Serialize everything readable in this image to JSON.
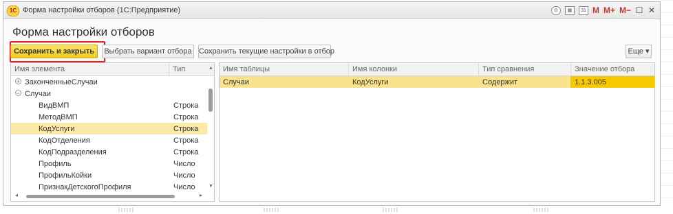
{
  "window": {
    "title": "Форма настройки отборов  (1С:Предприятие)",
    "logo_text": "1С",
    "controls": {
      "m": "M",
      "m_plus": "M+",
      "m_minus": "M−",
      "maximize": "☐",
      "close": "✕"
    }
  },
  "form": {
    "title": "Форма настройки отборов"
  },
  "toolbar": {
    "save_close": "Сохранить и закрыть",
    "choose_variant": "Выбрать вариант отбора",
    "save_current": "Сохранить текущие настройки в отбор",
    "more": "Еще ▾"
  },
  "left_table": {
    "columns": [
      "Имя элемента",
      "Тип"
    ],
    "rows": [
      {
        "name": "ЗаконченныеСлучаи",
        "type": "",
        "sign": "+"
      },
      {
        "name": "Случаи",
        "type": "",
        "sign": "−"
      },
      {
        "name": "ВидВМП",
        "type": "Строка"
      },
      {
        "name": "МетодВМП",
        "type": "Строка"
      },
      {
        "name": "КодУслуги",
        "type": "Строка",
        "selected": true
      },
      {
        "name": "КодОтделения",
        "type": "Строка"
      },
      {
        "name": "КодПодразделения",
        "type": "Строка"
      },
      {
        "name": "Профиль",
        "type": "Число"
      },
      {
        "name": "ПрофильКойки",
        "type": "Число"
      },
      {
        "name": "ПризнакДетскогоПрофиля",
        "type": "Число"
      }
    ]
  },
  "right_table": {
    "columns": [
      "Имя таблицы",
      "Имя колонки",
      "Тип сравнения",
      "Значение отбора"
    ],
    "rows": [
      {
        "table": "Случаи",
        "column": "КодУслуги",
        "comparison": "Содержит",
        "value": "1.1.3.005"
      }
    ]
  },
  "colors": {
    "accent_yellow": "#f0cc20",
    "selection": "#fbe9a8",
    "highlight_border": "#e31e1e"
  }
}
